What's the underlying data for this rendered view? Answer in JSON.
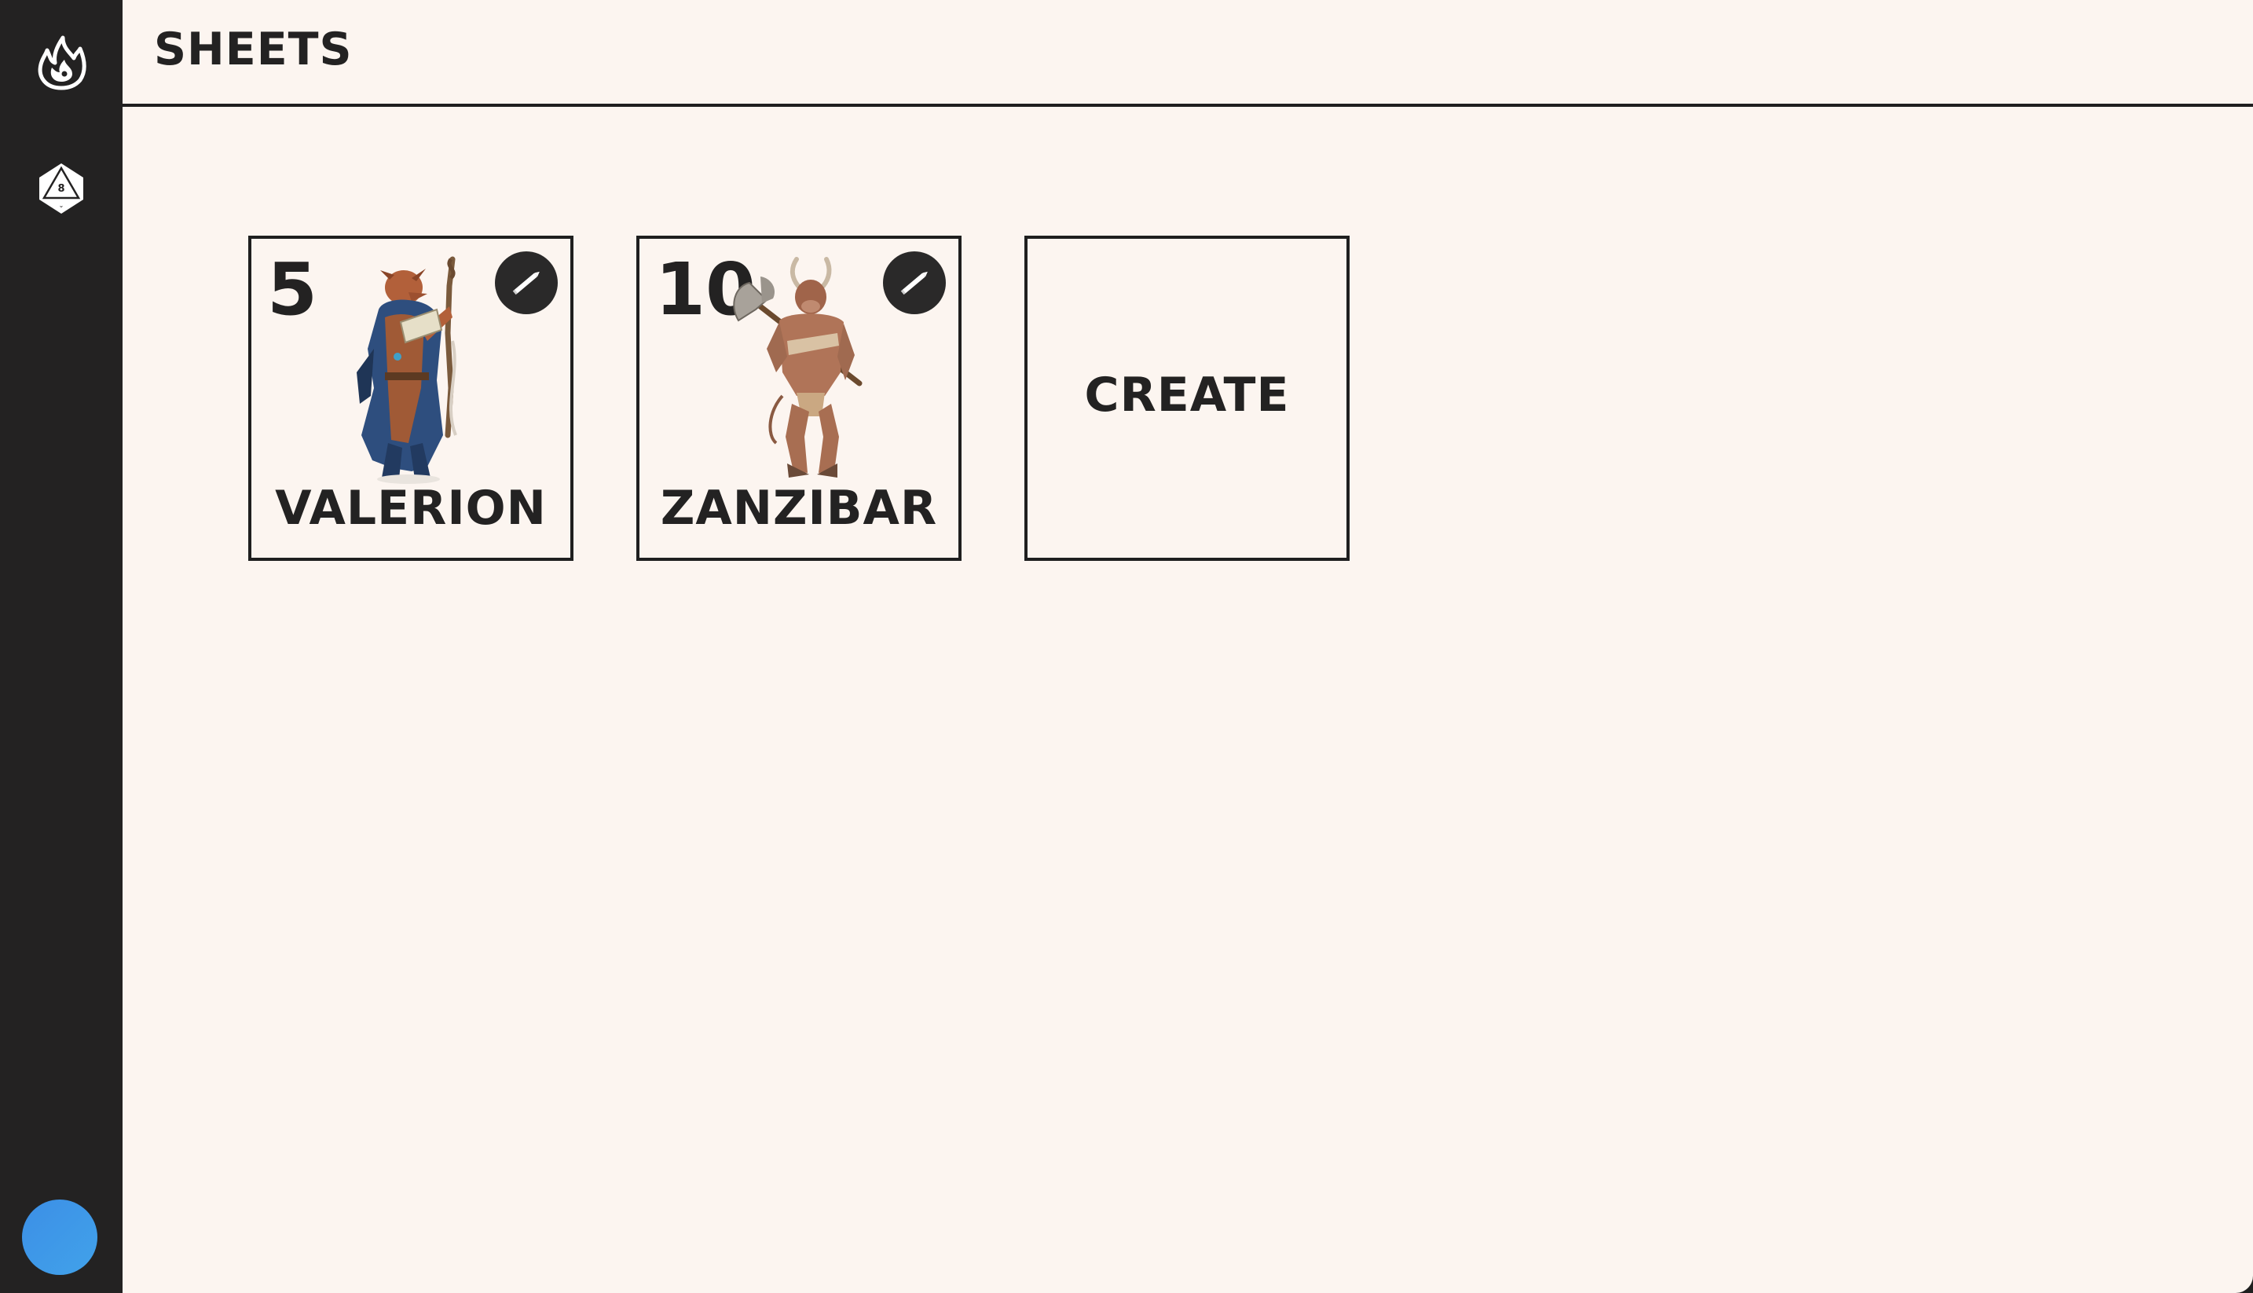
{
  "header": {
    "title": "SHEETS"
  },
  "sidebar": {
    "items": [
      {
        "icon": "flame-logo-icon"
      },
      {
        "icon": "d8-dice-icon",
        "die_label": "8"
      }
    ],
    "avatar_colors": [
      "#3c8fe6",
      "#41a2ea"
    ]
  },
  "sheets": [
    {
      "level": "5",
      "name": "VALERION",
      "portrait": "dragonborn-mage-portrait"
    },
    {
      "level": "10",
      "name": "ZANZIBAR",
      "portrait": "minotaur-warrior-portrait"
    }
  ],
  "create_card": {
    "label": "CREATE"
  },
  "colors": {
    "sidebar_bg": "#232222",
    "content_bg": "#fcf5f0",
    "text": "#232222",
    "border": "#1f1f1f"
  }
}
